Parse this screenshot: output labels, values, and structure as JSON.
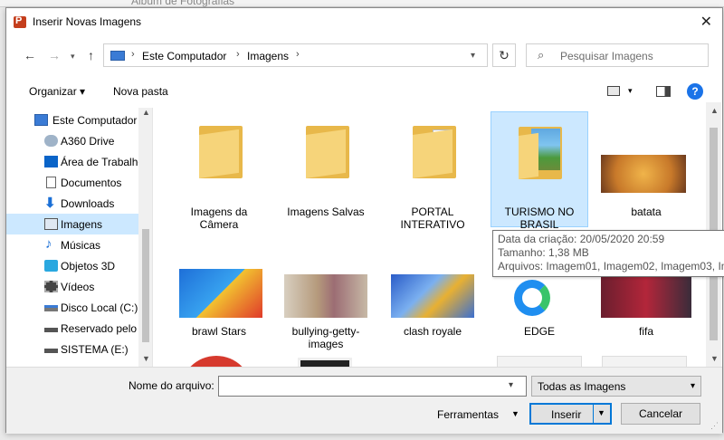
{
  "behind_window": {
    "title": "Álbum de Fotografias"
  },
  "window": {
    "title": "Inserir Novas Imagens"
  },
  "address_bar": {
    "crumbs": [
      "Este Computador",
      "Imagens"
    ]
  },
  "search": {
    "placeholder": "Pesquisar Imagens"
  },
  "toolbar": {
    "organize_label": "Organizar ▾",
    "new_folder_label": "Nova pasta",
    "help_label": "?"
  },
  "sidebar": {
    "items": [
      {
        "label": "Este Computador",
        "icon": "computer-icon"
      },
      {
        "label": "A360 Drive",
        "icon": "cloud-icon"
      },
      {
        "label": "Área de Trabalho",
        "icon": "desktop-icon"
      },
      {
        "label": "Documentos",
        "icon": "document-icon"
      },
      {
        "label": "Downloads",
        "icon": "download-icon"
      },
      {
        "label": "Imagens",
        "icon": "pictures-icon",
        "selected": true
      },
      {
        "label": "Músicas",
        "icon": "music-icon"
      },
      {
        "label": "Objetos 3D",
        "icon": "cube-icon"
      },
      {
        "label": "Vídeos",
        "icon": "video-icon"
      },
      {
        "label": "Disco Local (C:)",
        "icon": "drive-icon"
      },
      {
        "label": "Reservado pelo Sistema",
        "icon": "drive-icon"
      },
      {
        "label": "SISTEMA (E:)",
        "icon": "drive-icon"
      }
    ]
  },
  "files": [
    {
      "name": "Imagens da Câmera",
      "type": "folder"
    },
    {
      "name": "Imagens Salvas",
      "type": "folder"
    },
    {
      "name": "PORTAL INTERATIVO",
      "type": "folder"
    },
    {
      "name": "TURISMO NO BRASIL",
      "type": "folder",
      "selected": true
    },
    {
      "name": "batata",
      "type": "image"
    },
    {
      "name": "brawl Stars",
      "type": "image"
    },
    {
      "name": "bullying-getty-images",
      "type": "image"
    },
    {
      "name": "clash royale",
      "type": "image"
    },
    {
      "name": "EDGE",
      "type": "image"
    },
    {
      "name": "fifa",
      "type": "image"
    }
  ],
  "tooltip": {
    "line1": "Data da criação: 20/05/2020 20:59",
    "line2": "Tamanho: 1,38 MB",
    "line3": "Arquivos: Imagem01, Imagem02, Imagem03, Im"
  },
  "footer": {
    "filename_label": "Nome do arquivo:",
    "filename_value": "",
    "filetype_value": "Todas as Imagens",
    "tools_label": "Ferramentas",
    "insert_label": "Inserir",
    "cancel_label": "Cancelar"
  },
  "colors": {
    "accent": "#0078d7",
    "selection": "#cce8ff",
    "folder": "#f6d47a"
  }
}
